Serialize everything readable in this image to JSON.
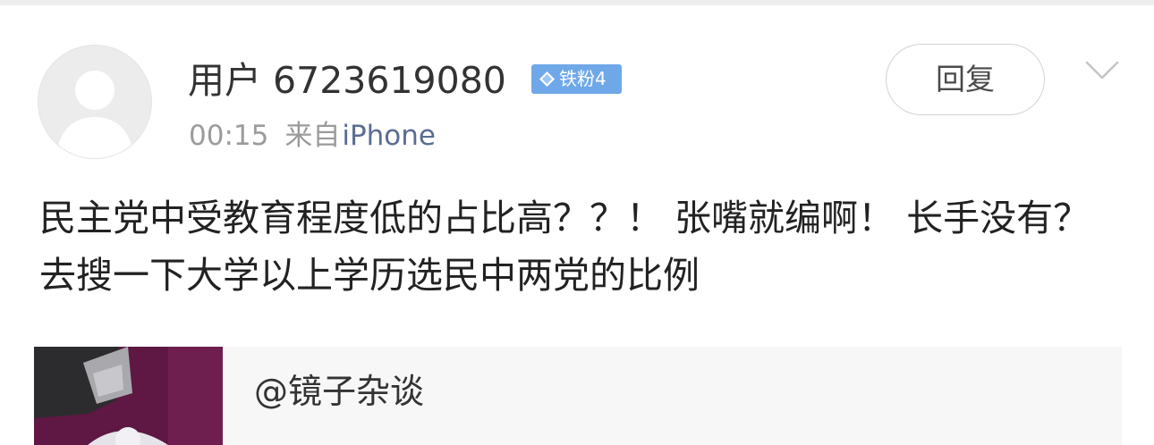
{
  "post": {
    "user": {
      "name": "用户 6723619080",
      "badge_label": "铁粉4",
      "avatar_icon": "default-avatar-icon"
    },
    "reply_label": "回复",
    "time": "00:15",
    "source_prefix": "来自",
    "source_device": "iPhone",
    "text": "民主党中受教育程度低的占比高？？！ 张嘴就编啊！ 长手没有？ 去搜一下大学以上学历选民中两党的比例"
  },
  "quote": {
    "name": "@镜子杂谈"
  },
  "colors": {
    "badge": "#6fa8e8",
    "device_link": "#5a6d92",
    "meta_gray": "#9b9b9b",
    "quote_bg": "#f7f7f7"
  }
}
